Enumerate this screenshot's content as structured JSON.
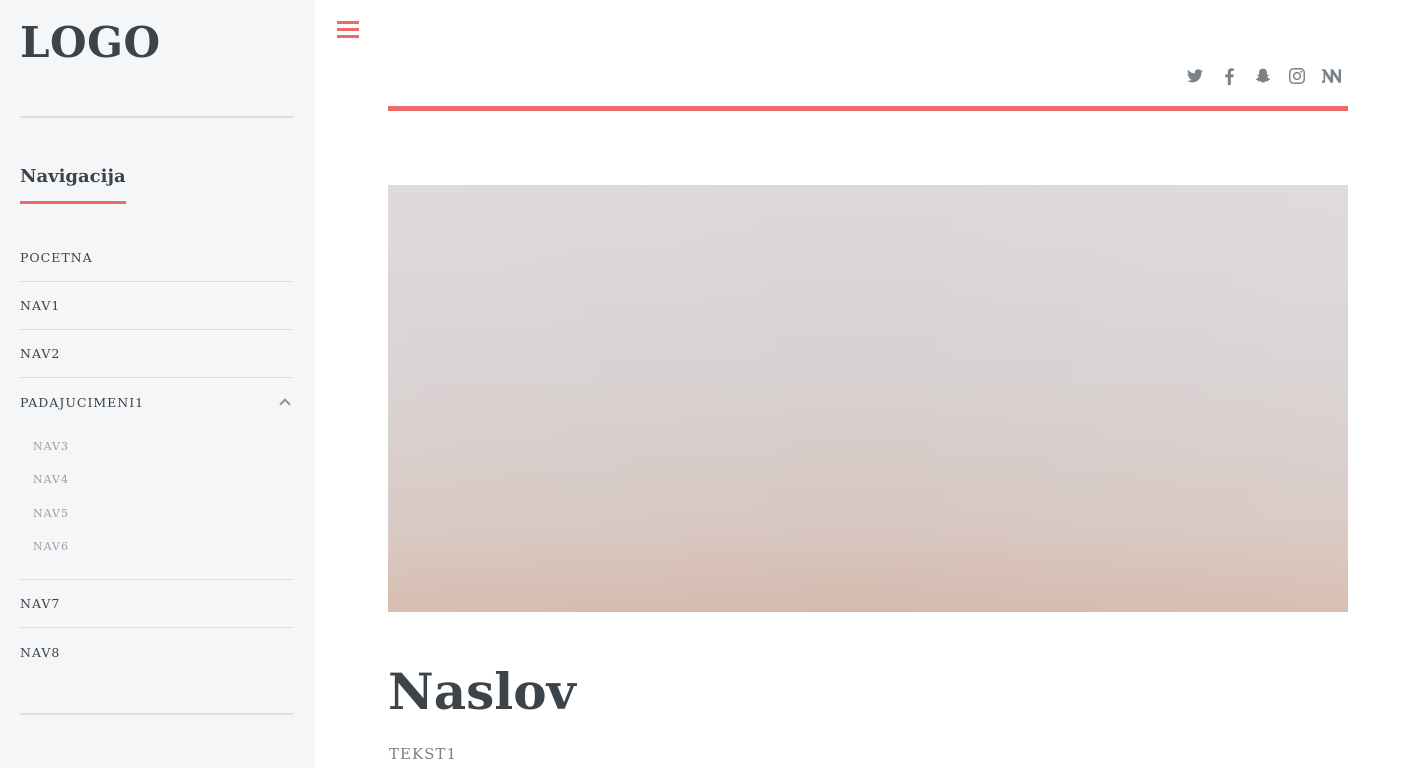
{
  "sidebar": {
    "logo": "LOGO",
    "nav_title": "Navigacija",
    "items": [
      {
        "label": "POCETNA"
      },
      {
        "label": "NAV1"
      },
      {
        "label": "NAV2"
      },
      {
        "label": "PADAJUCIMENI1",
        "expanded": true,
        "icon": "chevron-up-icon",
        "children": [
          {
            "label": "NAV3"
          },
          {
            "label": "NAV4"
          },
          {
            "label": "NAV5"
          },
          {
            "label": "NAV6"
          }
        ]
      },
      {
        "label": "NAV7"
      },
      {
        "label": "NAV8"
      }
    ]
  },
  "header": {
    "menu_icon": "hamburger-icon",
    "social_icons": [
      "twitter-icon",
      "facebook-icon",
      "snapchat-icon",
      "instagram-icon",
      "medium-icon"
    ]
  },
  "article": {
    "title": "Naslov",
    "text": "TEKST1"
  },
  "colors": {
    "accent": "#eb6b6b",
    "sidebar_bg": "#f5f6f7",
    "text_dark": "#3d4449",
    "text_muted": "#9aa0a5"
  }
}
